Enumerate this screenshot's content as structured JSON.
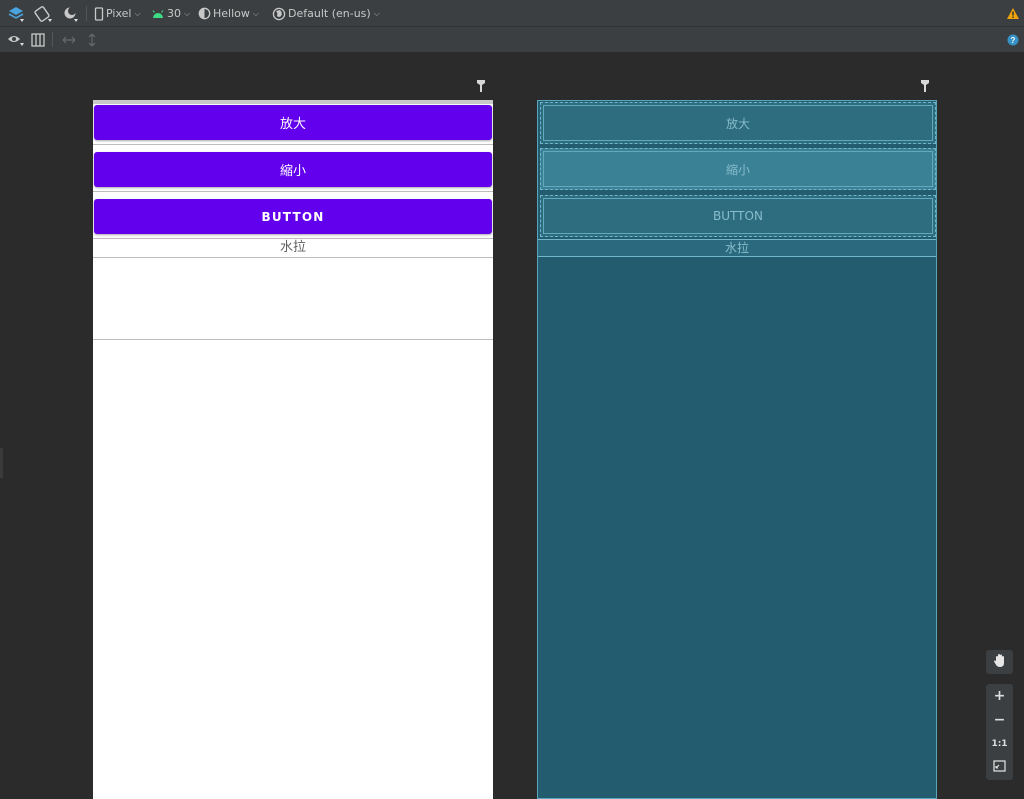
{
  "toolbar": {
    "device_label": "Pixel",
    "api_label": "30",
    "theme_label": "Hellow",
    "locale_label": "Default (en-us)"
  },
  "design_view": {
    "buttons": [
      "放大",
      "縮小",
      "BUTTON"
    ],
    "text_label": "水拉"
  },
  "blueprint_view": {
    "buttons": [
      "放大",
      "縮小",
      "BUTTON"
    ],
    "text_label": "水拉"
  },
  "zoom": {
    "plus": "+",
    "minus": "−",
    "actual_size": "1:1"
  },
  "colors": {
    "button_purple": "#6200ee",
    "blueprint_bg": "#245c6f",
    "warning": "#f0a30a",
    "help": "#3592c4",
    "android_green": "#3ddc84"
  }
}
